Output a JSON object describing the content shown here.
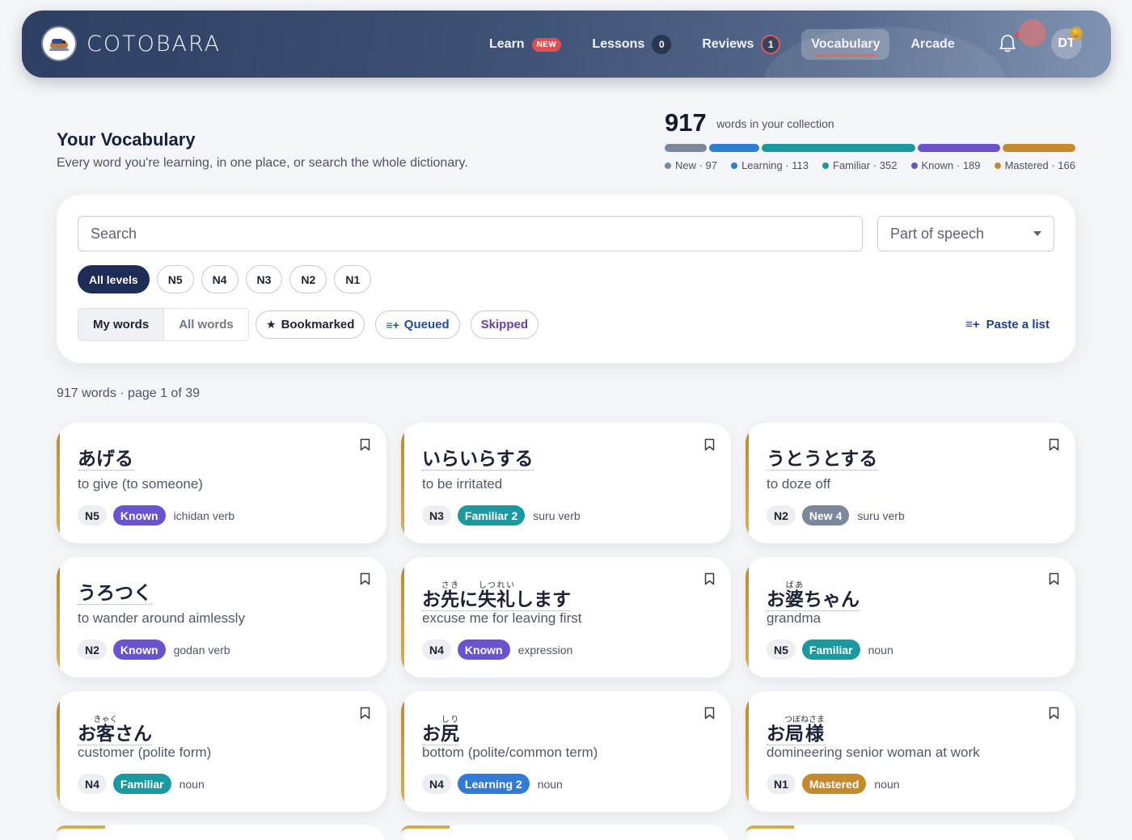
{
  "app": {
    "brand": "COTOBARA",
    "colors": {
      "nav_bg": "#3e5275",
      "accent": "#e36a56",
      "level_active": "#1d2d55"
    }
  },
  "nav": {
    "items": [
      {
        "label": "Learn",
        "badge": "NEW"
      },
      {
        "label": "Lessons",
        "count": "0"
      },
      {
        "label": "Reviews",
        "count": "1"
      },
      {
        "label": "Vocabulary",
        "active": true
      },
      {
        "label": "Arcade"
      }
    ],
    "avatar": "DT",
    "icons": {
      "bell": "bell-icon",
      "logo": "capybara-logo"
    }
  },
  "header": {
    "title": "Your Vocabulary",
    "subtitle": "Every word you're learning, in one place, or search the whole dictionary."
  },
  "stats": {
    "total": "917",
    "total_caption": "words in your collection",
    "segments": [
      {
        "label": "New · 97",
        "value": 97,
        "color": "#7a889d"
      },
      {
        "label": "Learning · 113",
        "value": 113,
        "color": "#2f7bd6"
      },
      {
        "label": "Familiar · 352",
        "value": 352,
        "color": "#1a9aa0"
      },
      {
        "label": "Known · 189",
        "value": 189,
        "color": "#6b53cf"
      },
      {
        "label": "Mastered · 166",
        "value": 166,
        "color": "#c58a2c"
      }
    ]
  },
  "search": {
    "placeholder": "Search",
    "pos_select": "Part of speech",
    "levels": [
      "All levels",
      "N5",
      "N4",
      "N3",
      "N2",
      "N1"
    ],
    "scope": [
      "My words",
      "All words"
    ],
    "filters": {
      "bookmarked": "Bookmarked",
      "queued": "Queued",
      "skipped": "Skipped"
    },
    "paste": "Paste a list"
  },
  "results": {
    "summary": "917 words · page 1 of 39"
  },
  "status_colors": {
    "New": "#7a889d",
    "Learning": "#2f7bd6",
    "Familiar": "#1a9aa0",
    "Known": "#6b53cf",
    "Mastered": "#c58a2c"
  },
  "cards": [
    {
      "word": "あげる",
      "meaning": "to give (to someone)",
      "level": "N5",
      "status": "Known",
      "status_type": "Known",
      "pos": "ichidan verb"
    },
    {
      "word": "いらいらする",
      "meaning": "to be irritated",
      "level": "N3",
      "status": "Familiar 2",
      "status_type": "Familiar",
      "pos": "suru verb"
    },
    {
      "word": "うとうとする",
      "meaning": "to doze off",
      "level": "N2",
      "status": "New 4",
      "status_type": "New",
      "pos": "suru verb"
    },
    {
      "word": "うろつく",
      "meaning": "to wander around aimlessly",
      "level": "N2",
      "status": "Known",
      "status_type": "Known",
      "pos": "godan verb"
    },
    {
      "word": "お先に失礼します",
      "ruby": [
        [
          "お",
          ""
        ],
        [
          "先",
          "さき"
        ],
        [
          "に",
          ""
        ],
        [
          "失礼",
          "しつれい"
        ],
        [
          "します",
          ""
        ]
      ],
      "meaning": "excuse me for leaving first",
      "level": "N4",
      "status": "Known",
      "status_type": "Known",
      "pos": "expression"
    },
    {
      "word": "お婆ちゃん",
      "ruby": [
        [
          "お",
          ""
        ],
        [
          "婆",
          "ばあ"
        ],
        [
          "ちゃん",
          ""
        ]
      ],
      "meaning": "grandma",
      "level": "N5",
      "status": "Familiar",
      "status_type": "Familiar",
      "pos": "noun"
    },
    {
      "word": "お客さん",
      "ruby": [
        [
          "お",
          ""
        ],
        [
          "客",
          "きゃく"
        ],
        [
          "さん",
          ""
        ]
      ],
      "meaning": "customer (polite form)",
      "level": "N4",
      "status": "Familiar",
      "status_type": "Familiar",
      "pos": "noun"
    },
    {
      "word": "お尻",
      "ruby": [
        [
          "お",
          ""
        ],
        [
          "尻",
          "しり"
        ]
      ],
      "meaning": "bottom (polite/common term)",
      "level": "N4",
      "status": "Learning 2",
      "status_type": "Learning",
      "pos": "noun"
    },
    {
      "word": "お局様",
      "ruby": [
        [
          "お",
          ""
        ],
        [
          "局様",
          "つぼねさま"
        ]
      ],
      "meaning": "domineering senior woman at work",
      "level": "N1",
      "status": "Mastered",
      "status_type": "Mastered",
      "pos": "noun"
    }
  ]
}
